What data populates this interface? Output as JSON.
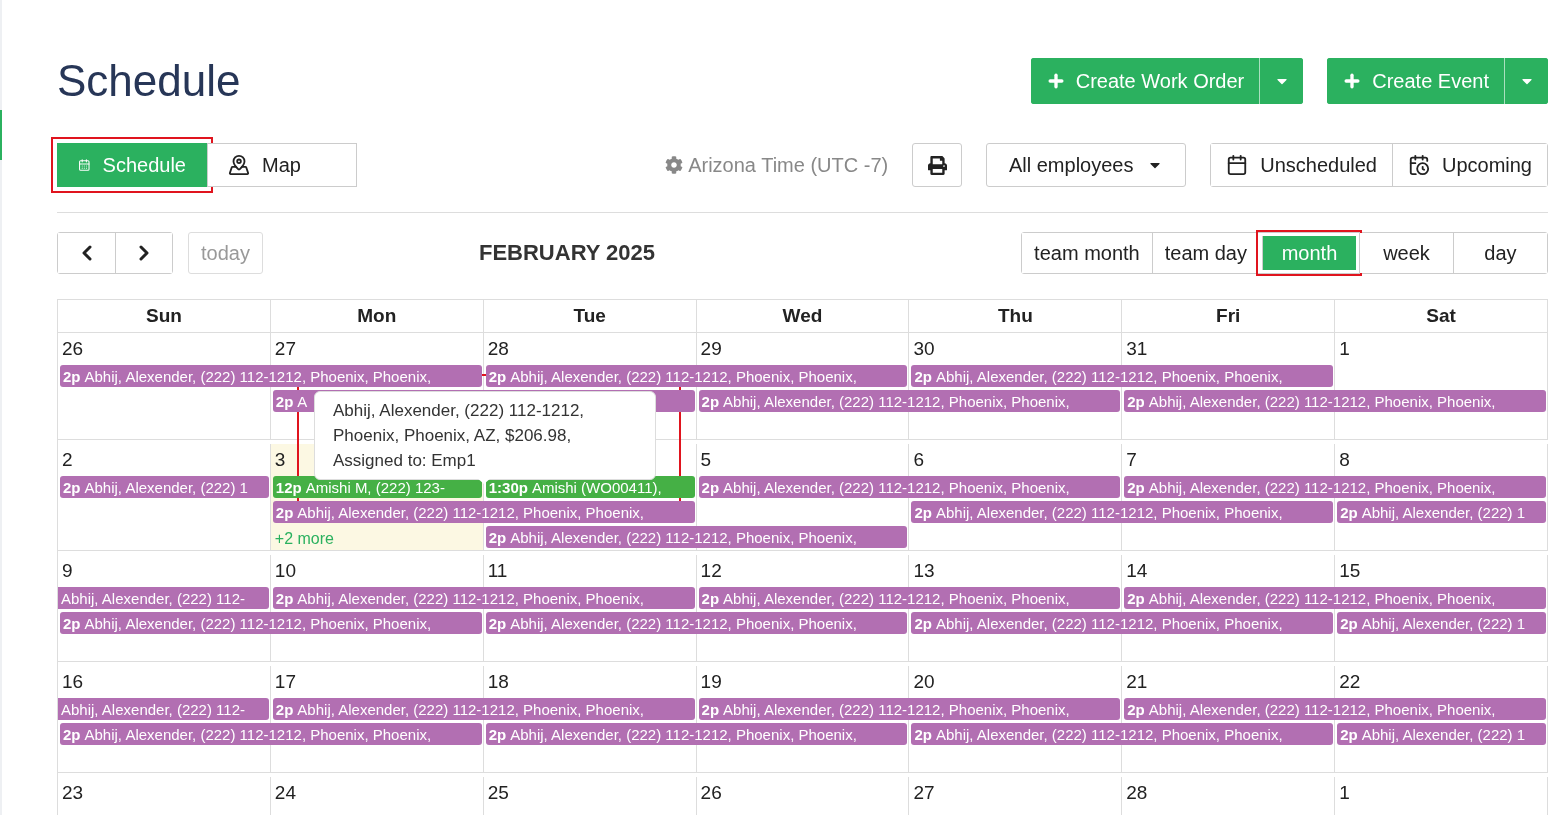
{
  "title": "Schedule",
  "actions": [
    {
      "label": "Create Work Order"
    },
    {
      "label": "Create Event"
    }
  ],
  "view_tabs": [
    {
      "kind": "schedule",
      "label": "Schedule",
      "selected": true,
      "highlighted": true
    },
    {
      "kind": "map",
      "label": "Map",
      "selected": false,
      "highlighted": false
    }
  ],
  "timezone": "Arizona Time (UTC -7)",
  "employee_filter": "All employees",
  "lists": [
    {
      "kind": "unscheduled",
      "label": "Unscheduled"
    },
    {
      "kind": "upcoming",
      "label": "Upcoming"
    }
  ],
  "today_button": {
    "label": "today",
    "disabled": true
  },
  "calendar_title": "FEBRUARY 2025",
  "calendar_views": [
    {
      "label": "team month",
      "selected": false,
      "highlighted": false
    },
    {
      "label": "team day",
      "selected": false,
      "highlighted": false
    },
    {
      "label": "month",
      "selected": true,
      "highlighted": true
    },
    {
      "label": "week",
      "selected": false,
      "highlighted": false
    },
    {
      "label": "day",
      "selected": false,
      "highlighted": false
    }
  ],
  "weekdays": [
    "Sun",
    "Mon",
    "Tue",
    "Wed",
    "Thu",
    "Fri",
    "Sat"
  ],
  "weeks": [
    {
      "days": [
        {
          "number": "26",
          "today": false
        },
        {
          "number": "27",
          "today": false
        },
        {
          "number": "28",
          "today": false
        },
        {
          "number": "29",
          "today": false
        },
        {
          "number": "30",
          "today": false
        },
        {
          "number": "31",
          "today": false
        },
        {
          "number": "1",
          "today": false
        }
      ],
      "lanes": [
        [
          {
            "kind": "event",
            "time": "2p",
            "text": "Abhij, Alexender, (222) 112-1212, Phoenix, Phoenix,",
            "color": "#b26fb2"
          },
          {
            "kind": "covered"
          },
          {
            "kind": "event",
            "time": "2p",
            "text": "Abhij, Alexender, (222) 112-1212, Phoenix, Phoenix,",
            "color": "#b26fb2"
          },
          {
            "kind": "covered"
          },
          {
            "kind": "event",
            "time": "2p",
            "text": "Abhij, Alexender, (222) 112-1212, Phoenix, Phoenix,",
            "color": "#b26fb2"
          },
          {
            "kind": "covered"
          },
          {
            "kind": "empty"
          }
        ],
        [
          {
            "kind": "empty"
          },
          {
            "kind": "event",
            "time": "2p",
            "text": "A",
            "color": "#b26fb2"
          },
          {
            "kind": "covered"
          },
          {
            "kind": "event",
            "time": "2p",
            "text": "Abhij, Alexender, (222) 112-1212, Phoenix, Phoenix,",
            "color": "#b26fb2"
          },
          {
            "kind": "covered"
          },
          {
            "kind": "event",
            "time": "2p",
            "text": "Abhij, Alexender, (222) 112-1212, Phoenix, Phoenix,",
            "color": "#b26fb2"
          },
          {
            "kind": "covered"
          }
        ]
      ]
    },
    {
      "days": [
        {
          "number": "2",
          "today": false
        },
        {
          "number": "3",
          "today": true
        },
        {
          "today": false
        },
        {
          "number": "5",
          "today": false
        },
        {
          "number": "6",
          "today": false
        },
        {
          "number": "7",
          "today": false
        },
        {
          "number": "8",
          "today": false
        }
      ],
      "lanes": [
        [
          {
            "kind": "event",
            "time": "2p",
            "text": "Abhij, Alexender, (222) 1",
            "color": "#b26fb2"
          },
          {
            "kind": "event",
            "time": "12p",
            "text": "Amishi M, (222) 123-",
            "color": "#45b045"
          },
          {
            "kind": "event",
            "time": "1:30p",
            "text": "Amishi (WO00411),",
            "color": "#45b045"
          },
          {
            "kind": "event",
            "time": "2p",
            "text": "Abhij, Alexender, (222) 112-1212, Phoenix, Phoenix,",
            "color": "#b26fb2"
          },
          {
            "kind": "covered"
          },
          {
            "kind": "event",
            "time": "2p",
            "text": "Abhij, Alexender, (222) 112-1212, Phoenix, Phoenix,",
            "color": "#b26fb2"
          },
          {
            "kind": "covered"
          }
        ],
        [
          {
            "kind": "empty"
          },
          {
            "kind": "event",
            "time": "2p",
            "text": "Abhij, Alexender, (222) 112-1212, Phoenix, Phoenix,",
            "color": "#b26fb2"
          },
          {
            "kind": "covered"
          },
          {
            "kind": "empty"
          },
          {
            "kind": "event",
            "time": "2p",
            "text": "Abhij, Alexender, (222) 112-1212, Phoenix, Phoenix,",
            "color": "#b26fb2"
          },
          {
            "kind": "covered"
          },
          {
            "kind": "event",
            "time": "2p",
            "text": "Abhij, Alexender, (222) 1",
            "color": "#b26fb2"
          }
        ],
        [
          {
            "kind": "empty"
          },
          {
            "kind": "more",
            "text": "+2 more"
          },
          {
            "kind": "event",
            "time": "2p",
            "text": "Abhij, Alexender, (222) 112-1212, Phoenix, Phoenix,",
            "color": "#b26fb2"
          },
          {
            "kind": "covered"
          },
          {
            "kind": "empty"
          },
          {
            "kind": "empty"
          },
          {
            "kind": "empty"
          }
        ]
      ]
    },
    {
      "days": [
        {
          "number": "9",
          "today": false
        },
        {
          "number": "10",
          "today": false
        },
        {
          "number": "11",
          "today": false
        },
        {
          "number": "12",
          "today": false
        },
        {
          "number": "13",
          "today": false
        },
        {
          "number": "14",
          "today": false
        },
        {
          "number": "15",
          "today": false
        }
      ],
      "lanes": [
        [
          {
            "kind": "continuation",
            "text": "Abhij, Alexender, (222) 112-",
            "color": "#b26fb2"
          },
          {
            "kind": "event",
            "time": "2p",
            "text": "Abhij, Alexender, (222) 112-1212, Phoenix, Phoenix,",
            "color": "#b26fb2"
          },
          {
            "kind": "covered"
          },
          {
            "kind": "event",
            "time": "2p",
            "text": "Abhij, Alexender, (222) 112-1212, Phoenix, Phoenix,",
            "color": "#b26fb2"
          },
          {
            "kind": "covered"
          },
          {
            "kind": "event",
            "time": "2p",
            "text": "Abhij, Alexender, (222) 112-1212, Phoenix, Phoenix,",
            "color": "#b26fb2"
          },
          {
            "kind": "covered"
          }
        ],
        [
          {
            "kind": "event",
            "time": "2p",
            "text": "Abhij, Alexender, (222) 112-1212, Phoenix, Phoenix,",
            "color": "#b26fb2"
          },
          {
            "kind": "covered"
          },
          {
            "kind": "event",
            "time": "2p",
            "text": "Abhij, Alexender, (222) 112-1212, Phoenix, Phoenix,",
            "color": "#b26fb2"
          },
          {
            "kind": "covered"
          },
          {
            "kind": "event",
            "time": "2p",
            "text": "Abhij, Alexender, (222) 112-1212, Phoenix, Phoenix,",
            "color": "#b26fb2"
          },
          {
            "kind": "covered"
          },
          {
            "kind": "event",
            "time": "2p",
            "text": "Abhij, Alexender, (222) 1",
            "color": "#b26fb2"
          }
        ]
      ]
    },
    {
      "days": [
        {
          "number": "16",
          "today": false
        },
        {
          "number": "17",
          "today": false
        },
        {
          "number": "18",
          "today": false
        },
        {
          "number": "19",
          "today": false
        },
        {
          "number": "20",
          "today": false
        },
        {
          "number": "21",
          "today": false
        },
        {
          "number": "22",
          "today": false
        }
      ],
      "lanes": [
        [
          {
            "kind": "continuation",
            "text": "Abhij, Alexender, (222) 112-",
            "color": "#b26fb2"
          },
          {
            "kind": "event",
            "time": "2p",
            "text": "Abhij, Alexender, (222) 112-1212, Phoenix, Phoenix,",
            "color": "#b26fb2"
          },
          {
            "kind": "covered"
          },
          {
            "kind": "event",
            "time": "2p",
            "text": "Abhij, Alexender, (222) 112-1212, Phoenix, Phoenix,",
            "color": "#b26fb2"
          },
          {
            "kind": "covered"
          },
          {
            "kind": "event",
            "time": "2p",
            "text": "Abhij, Alexender, (222) 112-1212, Phoenix, Phoenix,",
            "color": "#b26fb2"
          },
          {
            "kind": "covered"
          }
        ],
        [
          {
            "kind": "event",
            "time": "2p",
            "text": "Abhij, Alexender, (222) 112-1212, Phoenix, Phoenix,",
            "color": "#b26fb2"
          },
          {
            "kind": "covered"
          },
          {
            "kind": "event",
            "time": "2p",
            "text": "Abhij, Alexender, (222) 112-1212, Phoenix, Phoenix,",
            "color": "#b26fb2"
          },
          {
            "kind": "covered"
          },
          {
            "kind": "event",
            "time": "2p",
            "text": "Abhij, Alexender, (222) 112-1212, Phoenix, Phoenix,",
            "color": "#b26fb2"
          },
          {
            "kind": "covered"
          },
          {
            "kind": "event",
            "time": "2p",
            "text": "Abhij, Alexender, (222) 1",
            "color": "#b26fb2"
          }
        ]
      ]
    },
    {
      "days": [
        {
          "number": "23",
          "today": false
        },
        {
          "number": "24",
          "today": false
        },
        {
          "number": "25",
          "today": false
        },
        {
          "number": "26",
          "today": false
        },
        {
          "number": "27",
          "today": false
        },
        {
          "number": "28",
          "today": false
        },
        {
          "number": "1",
          "today": false
        }
      ]
    }
  ],
  "tooltip": {
    "lines": [
      "Abhij, Alexender, (222) 112-1212,",
      "Phoenix, Phoenix, AZ, $206.98,",
      "Assigned to: Emp1"
    ],
    "highlighted": true
  }
}
